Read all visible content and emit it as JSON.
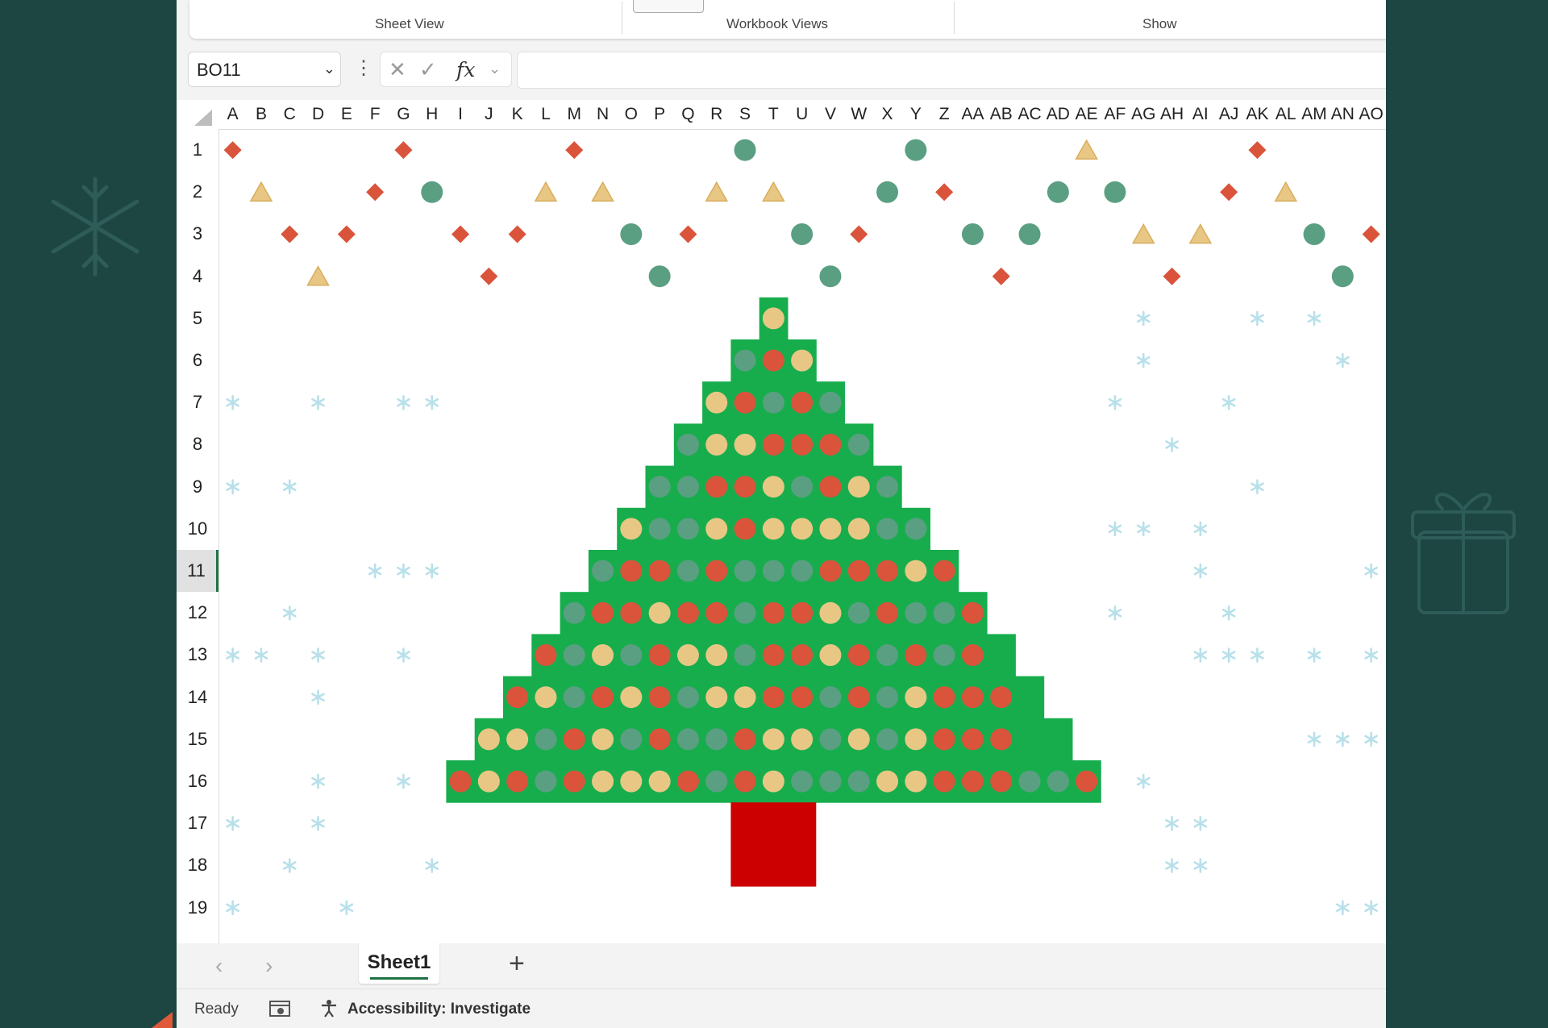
{
  "ribbon": {
    "groups": [
      "Sheet View",
      "Workbook Views",
      "Show"
    ]
  },
  "formula_bar": {
    "name_box": "BO11",
    "name_box_caret": "⌄",
    "more_icon": "⋮",
    "cancel_icon": "✕",
    "enter_icon": "✓",
    "fx_label": "fx",
    "fx_caret": "⌄",
    "formula_value": ""
  },
  "grid": {
    "columns": [
      "A",
      "B",
      "C",
      "D",
      "E",
      "F",
      "G",
      "H",
      "I",
      "J",
      "K",
      "L",
      "M",
      "N",
      "O",
      "P",
      "Q",
      "R",
      "S",
      "T",
      "U",
      "V",
      "W",
      "X",
      "Y",
      "Z",
      "AA",
      "AB",
      "AC",
      "AD",
      "AE",
      "AF",
      "AG",
      "AH",
      "AI",
      "AJ",
      "AK",
      "AL",
      "AM",
      "AN",
      "AO"
    ],
    "rows": [
      "1",
      "2",
      "3",
      "4",
      "5",
      "6",
      "7",
      "8",
      "9",
      "10",
      "11",
      "12",
      "13",
      "14",
      "15",
      "16",
      "17",
      "18",
      "19"
    ],
    "selected_row": "11",
    "selected_cell": "BO11",
    "tree_rows": [
      "Y",
      "GRY",
      "YRGRG",
      "GYYRRRG",
      "GGRRYGRYG",
      "YGGYRYYYYGG",
      "GRRGRGGGRRRYR",
      "GRRYRRGRRYGRGGR",
      "RGYGRYYGRRYRGRGR",
      "RYGRYRGYYRRGRGYRRR",
      "YYGRYGRGGRYYGYGYRRR",
      "RYRGRYYYRGRYGGGYYRRRGGR"
    ],
    "colors": {
      "tree_green": "#17ad4d",
      "ornament_red": "#d9543b",
      "ornament_teal": "#5a9f82",
      "ornament_yellow": "#e8c784",
      "trunk_red": "#cc0000",
      "snowflake": "#b8e0ea",
      "accent_green": "#217346",
      "background": "#1d4542"
    }
  },
  "sheet_tabs": {
    "prev_icon": "‹",
    "next_icon": "›",
    "active": "Sheet1",
    "add_icon": "+"
  },
  "status_bar": {
    "ready": "Ready",
    "accessibility": "Accessibility: Investigate"
  }
}
